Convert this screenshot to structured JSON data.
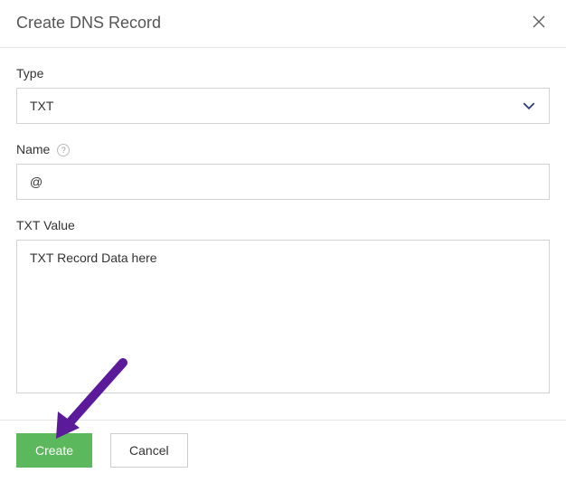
{
  "header": {
    "title": "Create DNS Record"
  },
  "fields": {
    "type": {
      "label": "Type",
      "value": "TXT"
    },
    "name": {
      "label": "Name",
      "value": "@"
    },
    "txt_value": {
      "label": "TXT Value",
      "value": "TXT Record Data here"
    }
  },
  "buttons": {
    "create": "Create",
    "cancel": "Cancel"
  }
}
